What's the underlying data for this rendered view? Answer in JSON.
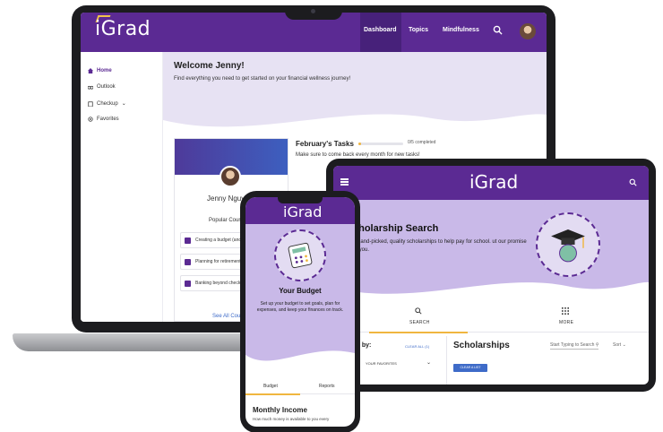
{
  "laptop": {
    "nav": {
      "logo": "iGrad",
      "links": [
        "Dashboard",
        "Topics",
        "Mindfulness"
      ],
      "active": "Dashboard"
    },
    "sidebar": {
      "items": [
        "Home",
        "Outlook",
        "Checkup",
        "Favorites"
      ]
    },
    "hero": {
      "title": "Welcome Jenny!",
      "subtitle": "Find everything you need to get started on your financial wellness journey!"
    },
    "profile": {
      "name": "Jenny Nguye",
      "section_title": "Popular Course",
      "courses": [
        "Creating a budget (and",
        "Planning for retirement",
        "Banking beyond check"
      ],
      "see_all": "See All Course"
    },
    "tasks": {
      "title": "February's Tasks",
      "status": "0/5 completed",
      "progress": 0.0,
      "subtitle": "Make sure to come back every month for new tasks!"
    }
  },
  "tablet": {
    "logo": "iGrad",
    "hero": {
      "title": "cholarship Search",
      "subtitle": "d hand-picked, quality scholarships to help pay for school. ut our promise to you."
    },
    "tabs": [
      "SEARCH",
      "MORE"
    ],
    "filter": {
      "label": "e by:",
      "clear_all": "CLEAR ALL (1)",
      "favorites": "YOUR FAVORITES"
    },
    "results": {
      "title": "Scholarships",
      "search_placeholder": "Start Typing to Search",
      "sort_label": "Sort",
      "clear_button": "CLEAR A LIST"
    }
  },
  "phone": {
    "logo": "iGrad",
    "hero": {
      "title": "Your Budget",
      "subtitle": "Set up your budget to set goals, plan for expenses, and keep your finances on track."
    },
    "tabs": [
      "Budget",
      "Reports"
    ],
    "section": {
      "title": "Monthly Income",
      "subtitle": "How much money is available to you every"
    }
  },
  "colors": {
    "brand_purple": "#5b2a93",
    "hero_lavender": "#c9b9e8",
    "accent_gold": "#f0b63f",
    "link_blue": "#3e6bc8"
  }
}
